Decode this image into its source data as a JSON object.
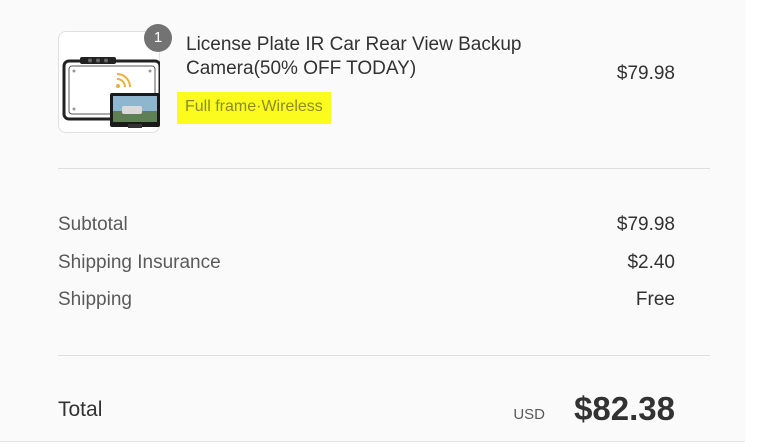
{
  "product": {
    "quantity": "1",
    "name": "License Plate IR Car Rear View Backup Camera(50% OFF TODAY)",
    "variant": "Full frame·Wireless",
    "price": "$79.98",
    "image_icon": "license-plate-camera-thumbnail"
  },
  "summary": {
    "rows": [
      {
        "label": "Subtotal",
        "value": "$79.98"
      },
      {
        "label": "Shipping Insurance",
        "value": "$2.40"
      },
      {
        "label": "Shipping",
        "value": "Free"
      }
    ]
  },
  "total": {
    "label": "Total",
    "currency": "USD",
    "amount": "$82.38"
  },
  "colors": {
    "highlight": "#fbfb1e",
    "badge": "#737373",
    "panel_background": "#fafafa"
  }
}
